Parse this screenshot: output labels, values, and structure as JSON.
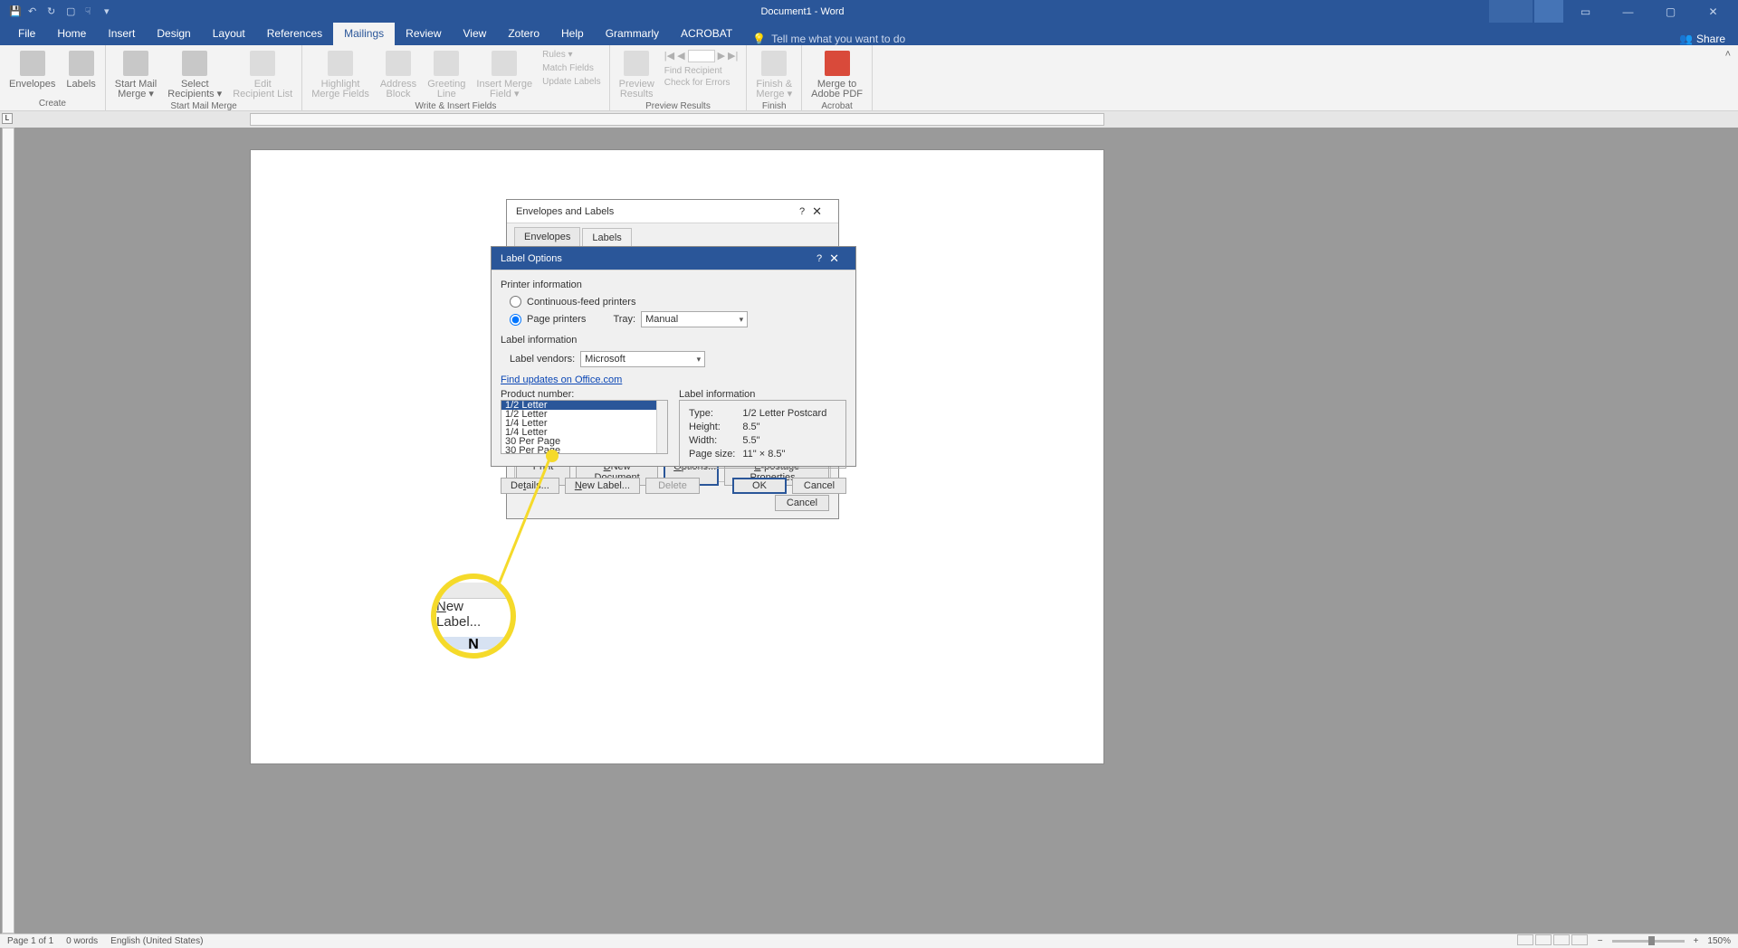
{
  "titlebar": {
    "title": "Document1 - Word"
  },
  "menu": {
    "tabs": [
      "File",
      "Home",
      "Insert",
      "Design",
      "Layout",
      "References",
      "Mailings",
      "Review",
      "View",
      "Zotero",
      "Help",
      "Grammarly",
      "ACROBAT"
    ],
    "active": "Mailings",
    "tell": "Tell me what you want to do",
    "share": "Share"
  },
  "ribbon": {
    "groups": [
      {
        "label": "Create",
        "buttons": [
          {
            "t": "Envelopes"
          },
          {
            "t": "Labels"
          }
        ]
      },
      {
        "label": "Start Mail Merge",
        "buttons": [
          {
            "t": "Start Mail\nMerge ▾"
          },
          {
            "t": "Select\nRecipients ▾"
          },
          {
            "t": "Edit\nRecipient List",
            "disabled": true
          }
        ]
      },
      {
        "label": "Write & Insert Fields",
        "buttons": [
          {
            "t": "Highlight\nMerge Fields",
            "disabled": true
          },
          {
            "t": "Address\nBlock",
            "disabled": true
          },
          {
            "t": "Greeting\nLine",
            "disabled": true
          },
          {
            "t": "Insert Merge\nField ▾",
            "disabled": true
          }
        ],
        "small": [
          "Rules ▾",
          "Match Fields",
          "Update Labels"
        ]
      },
      {
        "label": "Preview Results",
        "buttons": [
          {
            "t": "Preview\nResults",
            "disabled": true
          }
        ],
        "nav": [
          "|◀",
          "◀",
          "",
          "▶",
          "▶|"
        ],
        "small": [
          "Find Recipient",
          "Check for Errors"
        ]
      },
      {
        "label": "Finish",
        "buttons": [
          {
            "t": "Finish &\nMerge ▾",
            "disabled": true
          }
        ]
      },
      {
        "label": "Acrobat",
        "buttons": [
          {
            "t": "Merge to\nAdobe PDF"
          }
        ]
      }
    ]
  },
  "dialogs": {
    "envelopes": {
      "title": "Envelopes and Labels",
      "tabs": [
        "Envelopes",
        "Labels"
      ],
      "active_tab": "Labels",
      "buttons": [
        "Print",
        "New Document",
        "Options...",
        "E-postage Properties..."
      ],
      "cancel": "Cancel"
    },
    "label_options": {
      "title": "Label Options",
      "printer_info": "Printer information",
      "radio_continuous": "Continuous-feed printers",
      "radio_page": "Page printers",
      "tray_label": "Tray:",
      "tray_value": "Manual",
      "label_info": "Label information",
      "vendors_label": "Label vendors:",
      "vendors_value": "Microsoft",
      "find_updates": "Find updates on Office.com",
      "product_number": "Product number:",
      "products": [
        "1/2 Letter",
        "1/2 Letter",
        "1/4 Letter",
        "1/4 Letter",
        "30 Per Page",
        "30 Per Page"
      ],
      "info_title": "Label information",
      "info": {
        "Type:": "1/2 Letter Postcard",
        "Height:": "8.5\"",
        "Width:": "5.5\"",
        "Page size:": "11\" × 8.5\""
      },
      "details": "Details...",
      "new_label": "New Label...",
      "delete": "Delete",
      "ok": "OK",
      "cancel": "Cancel"
    }
  },
  "callout": {
    "text": "New Label...",
    "below": "N"
  },
  "status": {
    "page": "Page 1 of 1",
    "words": "0 words",
    "lang": "English (United States)",
    "zoom": "150%"
  }
}
